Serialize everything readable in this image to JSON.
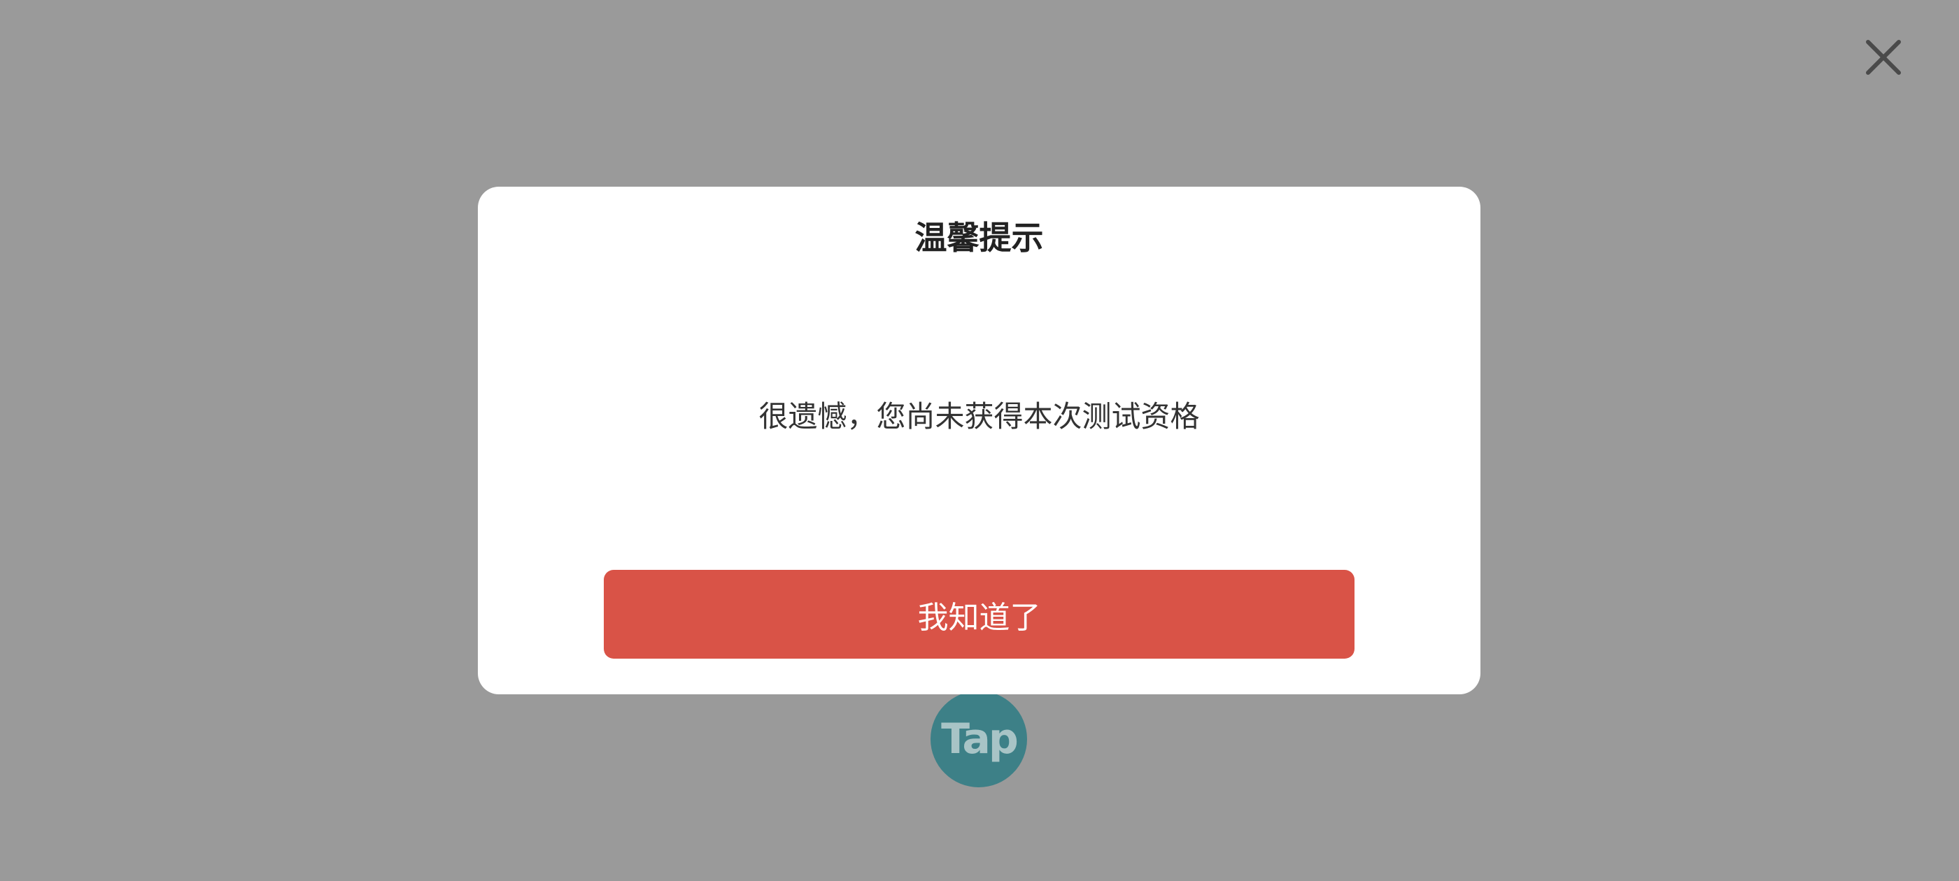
{
  "dialog": {
    "title": "温馨提示",
    "message": "很遗憾，您尚未获得本次测试资格",
    "confirm_label": "我知道了"
  },
  "logo": {
    "text": "Tap"
  },
  "icons": {
    "close": "close-icon"
  },
  "colors": {
    "overlay": "#9a9a9a",
    "dialog_bg": "#ffffff",
    "confirm_button": "#d95347",
    "logo_bg": "#3d8087"
  }
}
